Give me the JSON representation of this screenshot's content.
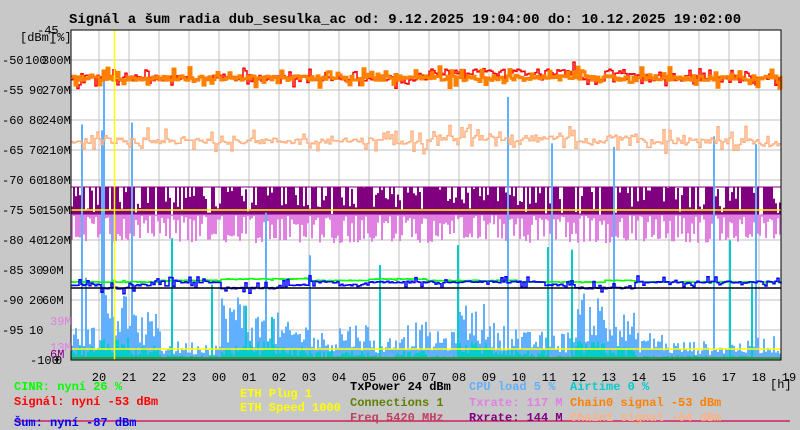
{
  "chart_data": {
    "type": "line",
    "title": "Signál a šum radia dub_sesulka_ac od: 9.12.2025 19:04:00 do: 10.12.2025 19:02:00",
    "xlabel": "[h]",
    "ylabel_dbm": "[dBm]",
    "ylabel_pct": "[%]",
    "x_ticks": [
      "20",
      "21",
      "22",
      "23",
      "00",
      "01",
      "02",
      "03",
      "04",
      "05",
      "06",
      "07",
      "08",
      "09",
      "10",
      "11",
      "12",
      "13",
      "14",
      "15",
      "16",
      "17",
      "18",
      "19"
    ],
    "y_ticks_dbm": [
      "-45",
      "-50",
      "-55",
      "-60",
      "-65",
      "-70",
      "-75",
      "-80",
      "-85",
      "-90",
      "-95",
      "-100"
    ],
    "y_ticks_pct": [
      "100",
      "90",
      "80",
      "70",
      "60",
      "50",
      "40",
      "30",
      "20",
      "10",
      "0"
    ],
    "y_ticks_rate": [
      "300M",
      "270M",
      "240M",
      "210M",
      "180M",
      "150M",
      "120M",
      "90M",
      "60M"
    ],
    "rate_markers": [
      {
        "label": "39M",
        "value": 39,
        "color": "#e080e0"
      },
      {
        "label": "13M",
        "value": 13,
        "color": "#e080e0"
      },
      {
        "label": "6M",
        "value": 6,
        "color": "#800080"
      }
    ],
    "ylim_dbm": [
      -100,
      -45
    ],
    "ylim_pct": [
      0,
      110
    ],
    "ylim_rate": [
      0,
      330
    ],
    "grid": true,
    "marker_time_hours": 1.45,
    "series": [
      {
        "name": "Signál",
        "axis": "dbm",
        "color": "#ff0000",
        "values": [
          -53,
          -53,
          -53,
          -53,
          -53,
          -53,
          -53,
          -53,
          -53,
          -53,
          -53,
          -53,
          -52,
          -52,
          -52,
          -52,
          -52,
          -53,
          -52,
          -53,
          -53,
          -53,
          -53,
          -53
        ]
      },
      {
        "name": "Chain0 signal",
        "axis": "dbm",
        "color": "#ff8000",
        "values": [
          -53,
          -53,
          -53,
          -53,
          -53,
          -53,
          -53,
          -53,
          -53,
          -53,
          -53,
          -53,
          -53,
          -53,
          -53,
          -53,
          -53,
          -53,
          -53,
          -53,
          -53,
          -53,
          -53,
          -53
        ]
      },
      {
        "name": "Chain1 signal",
        "axis": "dbm",
        "color": "#ffb080",
        "values": [
          -63.5,
          -63.5,
          -63.5,
          -63.5,
          -63.5,
          -63.5,
          -63.5,
          -63.5,
          -63.5,
          -63.5,
          -63.5,
          -63.5,
          -63,
          -63,
          -63,
          -63,
          -63,
          -63.5,
          -63,
          -63.5,
          -63.5,
          -63.5,
          -63.5,
          -64
        ]
      },
      {
        "name": "Šum",
        "axis": "dbm",
        "color": "#0000ff",
        "values": [
          -87.5,
          -88,
          -87.5,
          -87,
          -87,
          -88,
          -88,
          -87.5,
          -87,
          -87.5,
          -87,
          -87,
          -87,
          -87,
          -87,
          -87,
          -87.5,
          -88,
          -88,
          -87,
          -87,
          -87,
          -87,
          -87
        ]
      },
      {
        "name": "CINR",
        "axis": "pct",
        "color": "#00ff00",
        "values": [
          26,
          26,
          26,
          26.5,
          26.5,
          27,
          27,
          27,
          26.5,
          26.5,
          27,
          27,
          26.5,
          26.5,
          26.5,
          26,
          26,
          26,
          26.5,
          26,
          26,
          26,
          26,
          26
        ]
      },
      {
        "name": "TxPower",
        "axis": "pct",
        "color": "#000000",
        "values": [
          24,
          24,
          24,
          24,
          24,
          24,
          24,
          24,
          24,
          24,
          24,
          24,
          24,
          24,
          24,
          24,
          24,
          24,
          24,
          24,
          24,
          24,
          24,
          24
        ]
      },
      {
        "name": "Rxrate",
        "axis": "rate",
        "color": "#800080",
        "values": [
          158,
          155,
          160,
          158,
          162,
          150,
          158,
          150,
          160,
          155,
          158,
          150,
          160,
          158,
          158,
          155,
          160,
          150,
          155,
          158,
          160,
          162,
          160,
          150
        ]
      },
      {
        "name": "Txrate",
        "axis": "rate",
        "color": "#e080e0",
        "values": [
          130,
          128,
          132,
          130,
          128,
          125,
          130,
          135,
          130,
          128,
          130,
          128,
          130,
          130,
          130,
          128,
          130,
          125,
          128,
          130,
          130,
          130,
          130,
          120
        ]
      },
      {
        "name": "CPU load",
        "axis": "pct",
        "color": "#60b0ff",
        "values": [
          8,
          15,
          10,
          4,
          4,
          14,
          10,
          8,
          6,
          8,
          5,
          8,
          6,
          12,
          8,
          6,
          6,
          14,
          10,
          6,
          4,
          4,
          4,
          5
        ]
      },
      {
        "name": "Airtime",
        "axis": "pct",
        "color": "#00cccc",
        "values": [
          3,
          5,
          3,
          1,
          1,
          3,
          4,
          3,
          2,
          2,
          1,
          2,
          1,
          4,
          3,
          2,
          1,
          4,
          3,
          1,
          1,
          1,
          1,
          0
        ]
      },
      {
        "name": "ETH Speed",
        "axis": "rate",
        "color": "#ffff00",
        "values": [
          150
        ]
      },
      {
        "name": "ETH Plug",
        "axis": "rate",
        "color": "#ffff00",
        "values": [
          11
        ]
      },
      {
        "name": "Connections",
        "axis": "rate",
        "color": "#608000",
        "values": [
          2
        ]
      }
    ]
  },
  "legend": {
    "cinr": "CINR: nyní 26 %",
    "signal": "Signál: nyní -53 dBm",
    "noise": "Šum: nyní -87 dBm",
    "eth_plug": "ETH Plug 1",
    "eth_speed": "ETH Speed 1000",
    "txpower": "TxPower 24 dBm",
    "connections": "Connections 1",
    "freq": "Freq 5420 MHz",
    "cpu": "CPU load 5 %",
    "txrate": "Txrate: 117 M",
    "rxrate": "Rxrate: 144 M",
    "airtime": "Airtime 0 %",
    "chain0": "Chain0 signal -53 dBm",
    "chain1": "Chain1 signal -64 dBm"
  },
  "colors": {
    "freq": "#d02060",
    "grid": "#c0c0c0",
    "plot_bg": "#ffffff",
    "page_bg": "#c8c8c8"
  }
}
